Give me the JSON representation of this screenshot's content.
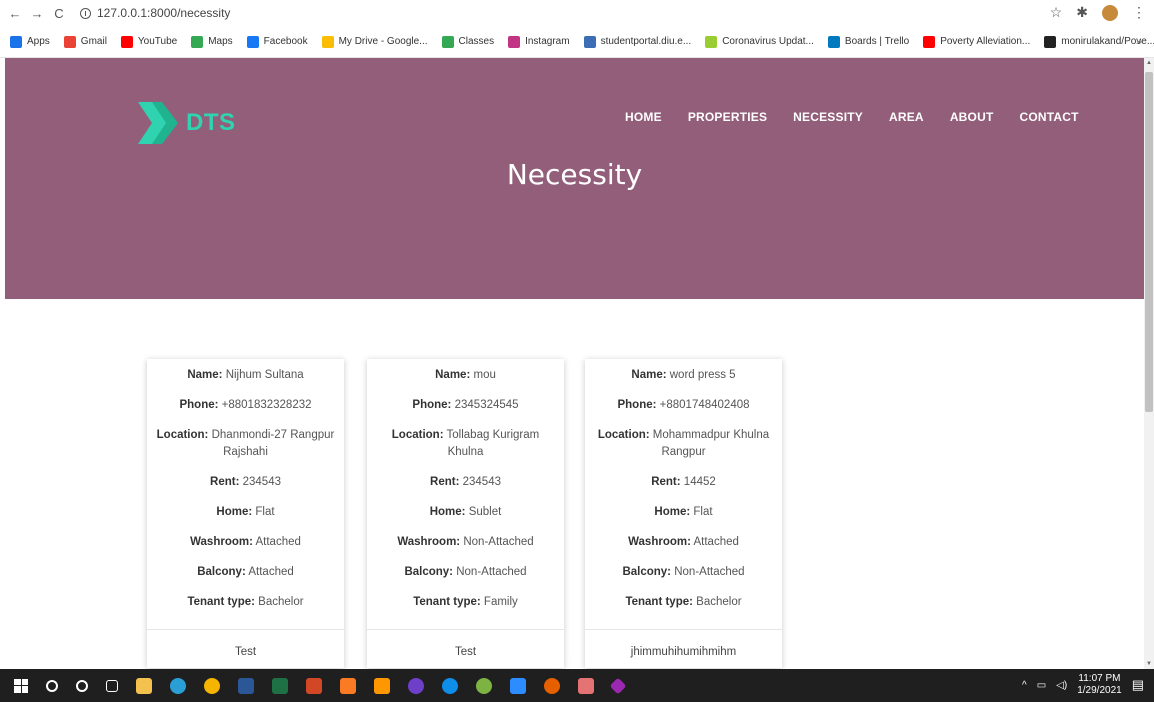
{
  "browser": {
    "url": "127.0.0.1:8000/necessity",
    "bookmarks": [
      {
        "label": "Apps",
        "color": "#1a73e8"
      },
      {
        "label": "Gmail",
        "color": "#ea4335"
      },
      {
        "label": "YouTube",
        "color": "#ff0000"
      },
      {
        "label": "Maps",
        "color": "#34a853"
      },
      {
        "label": "Facebook",
        "color": "#1877f2"
      },
      {
        "label": "My Drive - Google...",
        "color": "#fbbc04"
      },
      {
        "label": "Classes",
        "color": "#34a853"
      },
      {
        "label": "Instagram",
        "color": "#c13584"
      },
      {
        "label": "studentportal.diu.e...",
        "color": "#3d6db5"
      },
      {
        "label": "Coronavirus Updat...",
        "color": "#9acd32"
      },
      {
        "label": "Boards | Trello",
        "color": "#0079bf"
      },
      {
        "label": "Poverty Alleviation...",
        "color": "#ff0000"
      },
      {
        "label": "monirulakand/Pove...",
        "color": "#222222"
      }
    ],
    "more": "»"
  },
  "site": {
    "logo": "DTS",
    "nav": [
      "HOME",
      "PROPERTIES",
      "NECESSITY",
      "AREA",
      "ABOUT",
      "CONTACT"
    ],
    "title": "Necessity",
    "hero_color": "#925e7a",
    "accent": "#2fd3b0"
  },
  "labels": {
    "name": "Name:",
    "phone": "Phone:",
    "location": "Location:",
    "rent": "Rent:",
    "home": "Home:",
    "washroom": "Washroom:",
    "balcony": "Balcony:",
    "tenant": "Tenant type:"
  },
  "cards": [
    {
      "name": "Nijhum Sultana",
      "phone": "+8801832328232",
      "location": "Dhanmondi-27 Rangpur Rajshahi",
      "rent": "234543",
      "home": "Flat",
      "washroom": "Attached",
      "balcony": "Attached",
      "tenant": "Bachelor",
      "footer": "Test"
    },
    {
      "name": "mou",
      "phone": "2345324545",
      "location": "Tollabag Kurigram Khulna",
      "rent": "234543",
      "home": "Sublet",
      "washroom": "Non-Attached",
      "balcony": "Non-Attached",
      "tenant": "Family",
      "footer": "Test"
    },
    {
      "name": "word press 5",
      "phone": "+8801748402408",
      "location": "Mohammadpur Khulna Rangpur",
      "rent": "14452",
      "home": "Flat",
      "washroom": "Attached",
      "balcony": "Non-Attached",
      "tenant": "Bachelor",
      "footer": "jhimmuhihumihmihm"
    }
  ],
  "taskbar": {
    "time": "11:07 PM",
    "date": "1/29/2021"
  }
}
